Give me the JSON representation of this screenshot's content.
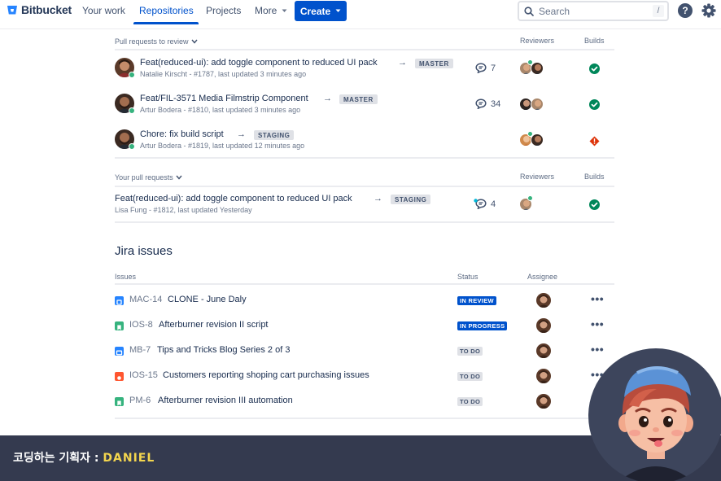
{
  "nav": {
    "logo": "Bitbucket",
    "items": [
      "Your work",
      "Repositories",
      "Projects",
      "More"
    ],
    "create_label": "Create",
    "search_placeholder": "Search",
    "search_shortcut": "/",
    "help_label": "?"
  },
  "review_section": {
    "title": "Pull requests to review",
    "col_reviewers": "Reviewers",
    "col_builds": "Builds",
    "rows": [
      {
        "title": "Feat(reduced-ui): add toggle component to reduced UI pack",
        "branch": "MASTER",
        "author": "Natalie Kirscht",
        "meta": " - #1787, last updated  3 minutes ago",
        "comments": "7",
        "build": "success"
      },
      {
        "title": "Feat/FIL-3571 Media Filmstrip Component",
        "branch": "MASTER",
        "author": "Artur Bodera",
        "meta": " - #1810, last updated 3 minutes ago",
        "comments": "34",
        "build": "success"
      },
      {
        "title": "Chore: fix build script",
        "branch": "STAGING",
        "author": "Artur Bodera",
        "meta": " - #1819, last updated  12 minutes ago",
        "comments": "",
        "build": "failed"
      }
    ]
  },
  "your_section": {
    "title": "Your pull requests",
    "col_reviewers": "Reviewers",
    "col_builds": "Builds",
    "rows": [
      {
        "title": "Feat(reduced-ui): add toggle component to reduced UI pack",
        "branch": "STAGING",
        "author": "Lisa Fung",
        "meta": " - #1812, last updated Yesterday",
        "comments": "4",
        "build": "success"
      }
    ]
  },
  "jira": {
    "title": "Jira issues",
    "col_issues": "Issues",
    "col_status": "Status",
    "col_assignee": "Assignee",
    "rows": [
      {
        "key": "MAC-14",
        "summary": "CLONE - June Daly",
        "status": "IN REVIEW",
        "type": "task"
      },
      {
        "key": "IOS-8",
        "summary": "Afterburner revision II script",
        "status": "IN PROGRESS",
        "type": "story"
      },
      {
        "key": "MB-7",
        "summary": "Tips and Tricks Blog Series 2 of 3",
        "status": "TO DO",
        "type": "task"
      },
      {
        "key": "IOS-15",
        "summary": "Customers reporting shoping cart purchasing issues",
        "status": "TO DO",
        "type": "bug"
      },
      {
        "key": "PM-6",
        "summary": "Afterburner revision III automation",
        "status": "TO DO",
        "type": "story"
      }
    ]
  },
  "banner": {
    "prefix": "코딩하는 기획자 : ",
    "name": "DANIEL"
  },
  "colors": {
    "brand": "#0052cc",
    "success": "#00875a",
    "danger": "#de350b",
    "banner_bg": "#343a4f",
    "banner_accent": "#f3d54e"
  }
}
